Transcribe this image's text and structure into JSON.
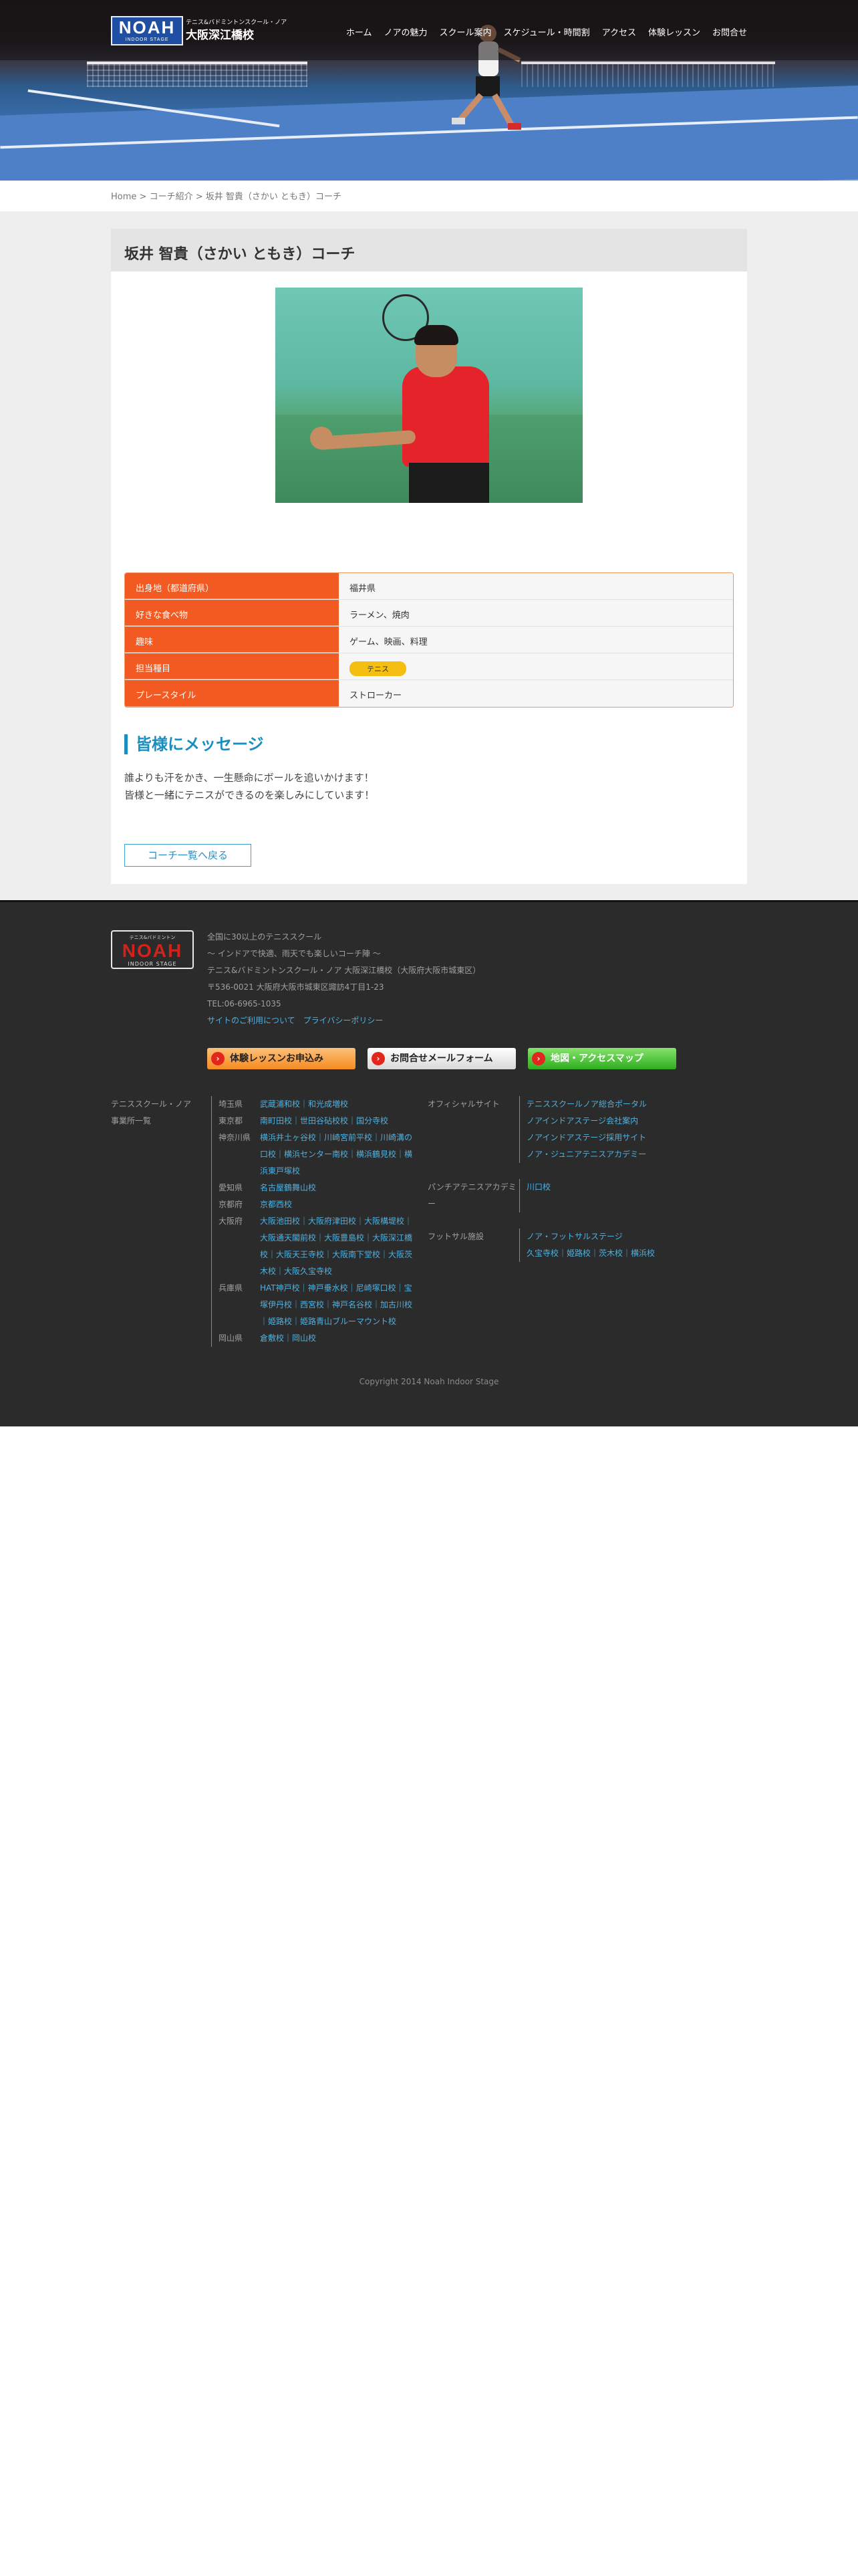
{
  "header": {
    "logo_mark": "NOAH",
    "logo_sub": "INDOOR STAGE",
    "logo_small": "テニス&バドミントンスクール・ノア",
    "logo_big": "大阪深江橋校",
    "nav": [
      "ホーム",
      "ノアの魅力",
      "スクール案内",
      "スケジュール・時間割",
      "アクセス",
      "体験レッスン",
      "お問合せ"
    ]
  },
  "breadcrumb": [
    "Home",
    ">",
    "コーチ紹介",
    ">",
    "坂井 智貴（さかい ともき）コーチ"
  ],
  "page_title": "坂井 智貴（さかい ともき）コーチ",
  "profile": [
    {
      "label": "出身地（都道府県）",
      "value": "福井県"
    },
    {
      "label": "好きな食べ物",
      "value": "ラーメン、焼肉"
    },
    {
      "label": "趣味",
      "value": "ゲーム、映画、料理"
    },
    {
      "label": "担当種目",
      "tag": "テニス"
    },
    {
      "label": "プレースタイル",
      "value": "ストローカー"
    }
  ],
  "message": {
    "heading": "皆様にメッセージ",
    "lines": [
      "誰よりも汗をかき、一生懸命にボールを追いかけます！",
      "皆様と一緒にテニスができるのを楽しみにしています！"
    ]
  },
  "back_button": "コーチ一覧へ戻る",
  "footer": {
    "logo_top": "テニス&バドミントン",
    "logo_mark": "NOAH",
    "logo_bottom": "INDOOR STAGE",
    "info": [
      "全国に30以上のテニススクール",
      "〜 インドアで快適、雨天でも楽しいコーチ陣 〜",
      "テニス&バドミントンスクール・ノア 大阪深江橋校（大阪府大阪市城東区）",
      "〒536-0021 大阪府大阪市城東区諏訪4丁目1-23",
      "TEL:06-6965-1035"
    ],
    "links": [
      "サイトのご利用について",
      "プライバシーポリシー"
    ],
    "buttons": [
      "体験レッスンお申込み",
      "お問合せメールフォーム",
      "地図・アクセスマップ"
    ],
    "left_links": [
      "テニススクール・ノア",
      "事業所一覧"
    ],
    "schools": [
      {
        "pref": "埼玉県",
        "names": "武蔵浦和校｜和光成増校"
      },
      {
        "pref": "東京都",
        "names": "南町田校｜世田谷砧校校｜国分寺校"
      },
      {
        "pref": "神奈川県",
        "names": "横浜井土ヶ谷校｜川崎宮前平校｜川崎溝の口校｜横浜センター南校｜横浜鶴見校｜横浜東戸塚校"
      },
      {
        "pref": "愛知県",
        "names": "名古屋鶴舞山校"
      },
      {
        "pref": "京都府",
        "names": "京都西校"
      },
      {
        "pref": "大阪府",
        "names": "大阪池田校｜大阪府津田校｜大阪構堤校｜大阪通天閣前校｜大阪豊島校｜大阪深江橋校｜大阪天王寺校｜大阪南下堂校｜大阪茨木校｜大阪久宝寺校"
      },
      {
        "pref": "兵庫県",
        "names": "HAT神戸校｜神戸垂水校｜尼崎塚口校｜宝塚伊丹校｜西宮校｜神戸名谷校｜加古川校｜姫路校｜姫路青山ブルーマウント校"
      },
      {
        "pref": "岡山県",
        "names": "倉敷校｜岡山校"
      }
    ],
    "other": [
      {
        "label": "オフィシャルサイト",
        "links": [
          "テニススクールノア総合ポータル",
          "ノアインドアステージ会社案内",
          "ノアインドアステージ採用サイト",
          "ノア・ジュニアテニスアカデミー"
        ]
      },
      {
        "label": "パンチアテニスアカデミー",
        "links": [
          "川口校"
        ]
      },
      {
        "label": "フットサル施設",
        "links": [
          "ノア・フットサルステージ",
          "久宝寺校｜姫路校｜茨木校｜横浜校"
        ]
      }
    ],
    "copyright": "Copyright 2014 Noah Indoor Stage"
  }
}
